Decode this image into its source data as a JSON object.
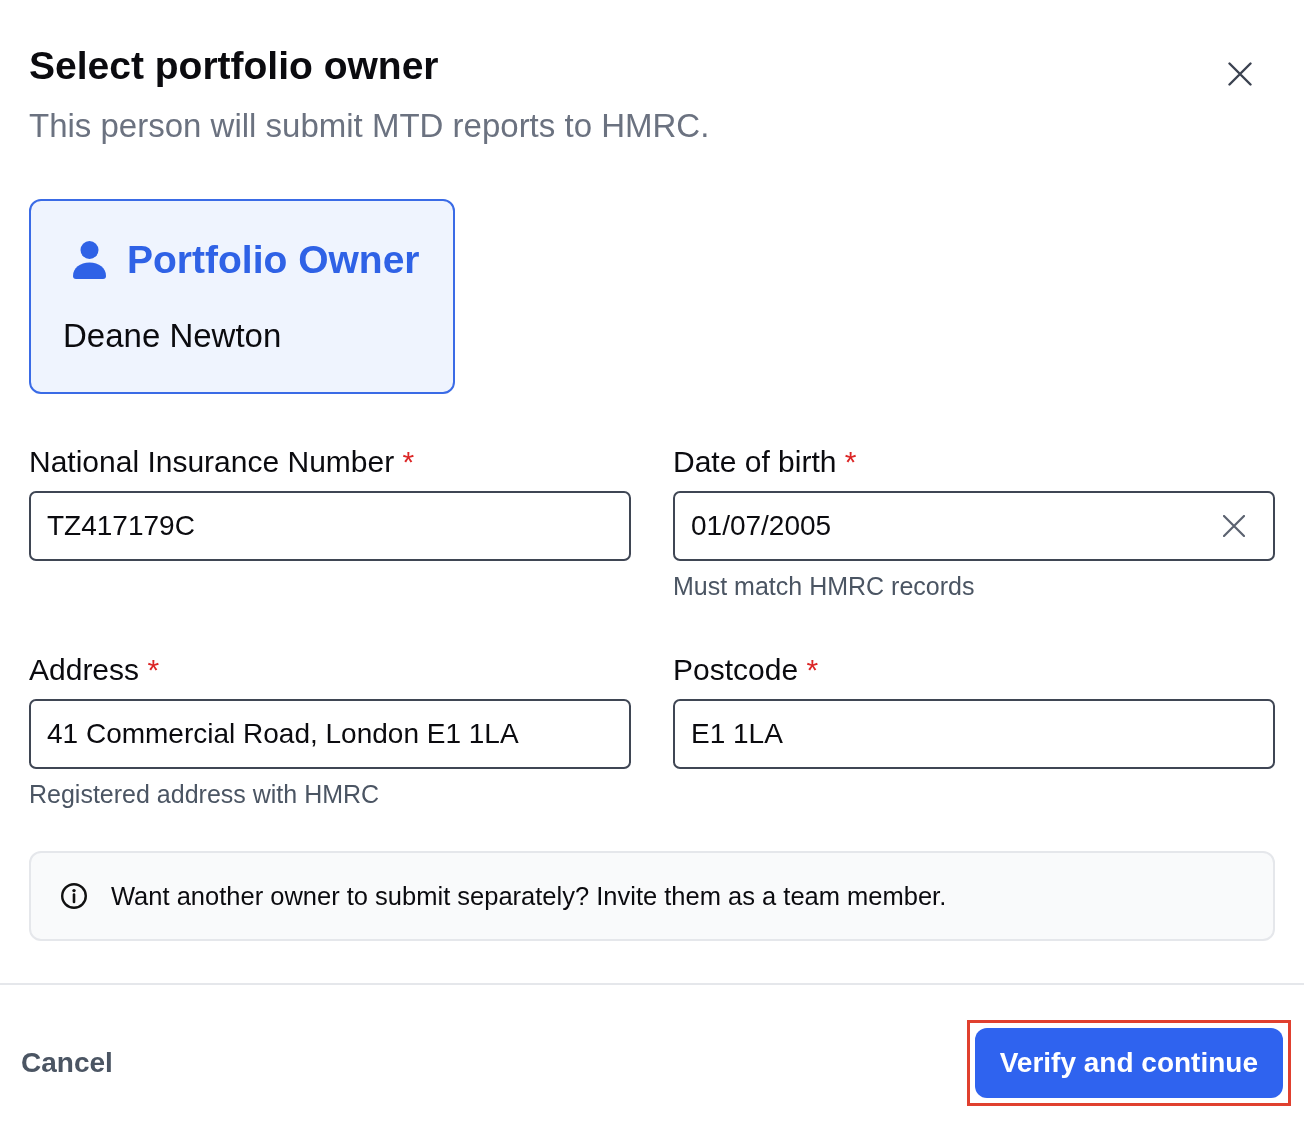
{
  "dialog": {
    "title": "Select portfolio owner",
    "subtitle": "This person will submit MTD reports to HMRC."
  },
  "owner_card": {
    "label": "Portfolio Owner",
    "name": "Deane Newton",
    "selected": true
  },
  "fields": [
    {
      "label": "National Insurance Number",
      "required_mark": "*",
      "value": "TZ417179C",
      "clearable": false
    },
    {
      "label": "Date of birth",
      "required_mark": "*",
      "value": "01/07/2005",
      "clearable": true,
      "hint": "Must match HMRC records"
    },
    {
      "label": "Address",
      "required_mark": "*",
      "value": "41 Commercial Road, London E1 1LA",
      "clearable": false,
      "hint": "Registered address with HMRC"
    },
    {
      "label": "Postcode",
      "required_mark": "*",
      "value": "E1 1LA",
      "clearable": false
    }
  ],
  "info": {
    "text": "Want another owner to submit separately? Invite them as a team member."
  },
  "footer": {
    "cancel": "Cancel",
    "primary": {
      "label": "Verify and continue",
      "highlighted": true
    }
  }
}
